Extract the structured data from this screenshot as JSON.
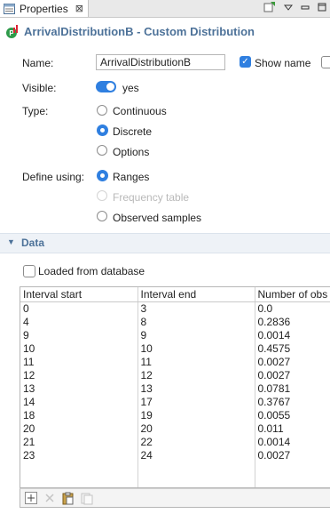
{
  "tab": {
    "label": "Properties",
    "close": "⊠"
  },
  "header": {
    "title": "ArrivalDistributionB - Custom Distribution"
  },
  "form": {
    "name_label": "Name:",
    "name_value": "ArrivalDistributionB",
    "show_name_label": "Show name",
    "visible_label": "Visible:",
    "visible_value": "yes",
    "type_label": "Type:",
    "type_options": [
      "Continuous",
      "Discrete",
      "Options"
    ],
    "type_selected": "Discrete",
    "define_label": "Define using:",
    "define_options": [
      "Ranges",
      "Frequency table",
      "Observed samples"
    ],
    "define_selected": "Ranges"
  },
  "data_section": {
    "title": "Data",
    "loaded_label": "Loaded from database"
  },
  "table": {
    "columns": [
      "Interval start",
      "Interval end",
      "Number of obs"
    ],
    "rows": [
      [
        "0",
        "3",
        "0.0"
      ],
      [
        "4",
        "8",
        "0.2836"
      ],
      [
        "9",
        "9",
        "0.0014"
      ],
      [
        "10",
        "10",
        "0.4575"
      ],
      [
        "11",
        "11",
        "0.0027"
      ],
      [
        "12",
        "12",
        "0.0027"
      ],
      [
        "13",
        "13",
        "0.0781"
      ],
      [
        "14",
        "17",
        "0.3767"
      ],
      [
        "18",
        "19",
        "0.0055"
      ],
      [
        "20",
        "20",
        "0.011"
      ],
      [
        "21",
        "22",
        "0.0014"
      ],
      [
        "23",
        "24",
        "0.0027"
      ],
      [
        "",
        "",
        ""
      ],
      [
        "",
        "",
        ""
      ]
    ]
  },
  "colors": {
    "accent": "#2f7fe0",
    "title": "#4d7299"
  }
}
